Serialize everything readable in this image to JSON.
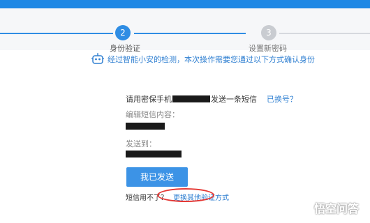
{
  "steps": [
    {
      "number": "2",
      "label": "身份验证",
      "state": "active"
    },
    {
      "number": "3",
      "label": "设置新密码",
      "state": "pending"
    }
  ],
  "notice": {
    "icon": "robot-icon",
    "text": "经过智能小安的检测，本次操作需要您通过以下方式确认身份"
  },
  "verify": {
    "prefix": "请用密保手机",
    "suffix": "发送一条短信",
    "changed_number_link": "已换号？",
    "edit_label": "编辑短信内容：",
    "send_to_label": "发送到：",
    "sent_button": "我已发送",
    "unavailable_text": "短信用不了？",
    "other_method_link": "更换其他验证方式"
  },
  "watermark": {
    "text": "悟空问答"
  },
  "colors": {
    "accent": "#2f8de4",
    "button": "#3c93e6",
    "highlight": "#e53935",
    "pending": "#c9ccd1"
  }
}
